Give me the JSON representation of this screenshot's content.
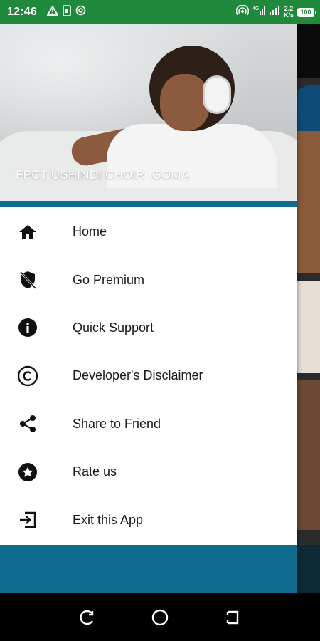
{
  "status_bar": {
    "time": "12:46",
    "speed_value": "2.2",
    "speed_unit": "K/s",
    "battery": "100",
    "left_icons": [
      "warning-icon",
      "sim-icon",
      "location-icon"
    ],
    "right_icons": [
      "hotspot-icon",
      "signal-icon",
      "signal-icon",
      "battery-icon"
    ]
  },
  "drawer": {
    "header_title": "FPCT USHINDI CHOIR IGOMA",
    "items": [
      {
        "label": "Home",
        "icon": "home-icon"
      },
      {
        "label": "Go Premium",
        "icon": "shield-off-icon"
      },
      {
        "label": "Quick Support",
        "icon": "info-icon"
      },
      {
        "label": "Developer's Disclaimer",
        "icon": "copyright-icon"
      },
      {
        "label": "Share to Friend",
        "icon": "share-icon"
      },
      {
        "label": "Rate us",
        "icon": "star-circle-icon"
      },
      {
        "label": "Exit this App",
        "icon": "exit-icon"
      }
    ]
  },
  "colors": {
    "status_bar": "#1f8a3c",
    "accent": "#0f6c8f",
    "drawer_bg": "#ffffff",
    "nav_bar": "#000000"
  },
  "nav_bar": {
    "buttons": [
      "recent-apps-icon",
      "home-circle-icon",
      "back-icon"
    ]
  }
}
